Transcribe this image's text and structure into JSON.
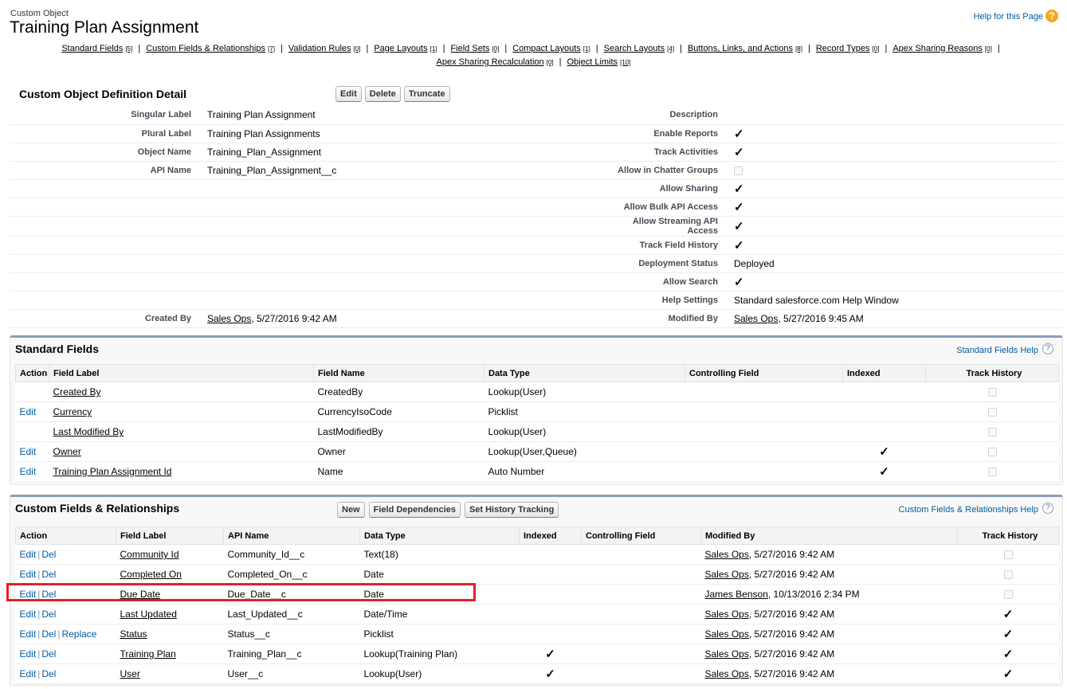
{
  "header": {
    "object_type": "Custom Object",
    "title": "Training Plan Assignment",
    "help_link": "Help for this Page",
    "help_icon": "?"
  },
  "related_links": [
    {
      "label": "Standard Fields",
      "count": "[5]"
    },
    {
      "label": "Custom Fields & Relationships",
      "count": "[7]"
    },
    {
      "label": "Validation Rules",
      "count": "[0]"
    },
    {
      "label": "Page Layouts",
      "count": "[1]"
    },
    {
      "label": "Field Sets",
      "count": "[0]"
    },
    {
      "label": "Compact Layouts",
      "count": "[1]"
    },
    {
      "label": "Search Layouts",
      "count": "[4]"
    },
    {
      "label": "Buttons, Links, and Actions",
      "count": "[8]"
    },
    {
      "label": "Record Types",
      "count": "[0]"
    },
    {
      "label": "Apex Sharing Reasons",
      "count": "[0]"
    },
    {
      "label": "Apex Sharing Recalculation",
      "count": "[0]"
    },
    {
      "label": "Object Limits",
      "count": "[10]"
    }
  ],
  "detail": {
    "title": "Custom Object Definition Detail",
    "buttons": {
      "edit": "Edit",
      "delete": "Delete",
      "truncate": "Truncate"
    },
    "left": [
      {
        "label": "Singular Label",
        "value": "Training Plan Assignment"
      },
      {
        "label": "Plural Label",
        "value": "Training Plan Assignments"
      },
      {
        "label": "Object Name",
        "value": "Training_Plan_Assignment"
      },
      {
        "label": "API Name",
        "value": "Training_Plan_Assignment__c"
      }
    ],
    "right": [
      {
        "label": "Description",
        "value": ""
      },
      {
        "label": "Enable Reports",
        "checked": true
      },
      {
        "label": "Track Activities",
        "checked": true
      },
      {
        "label": "Allow in Chatter Groups",
        "checked": false
      },
      {
        "label": "Allow Sharing",
        "checked": true
      },
      {
        "label": "Allow Bulk API Access",
        "checked": true
      },
      {
        "label": "Allow Streaming API Access",
        "checked": true
      },
      {
        "label": "Track Field History",
        "checked": true
      },
      {
        "label": "Deployment Status",
        "value": "Deployed"
      },
      {
        "label": "Allow Search",
        "checked": true
      },
      {
        "label": "Help Settings",
        "value": "Standard salesforce.com Help Window"
      }
    ],
    "created_by": {
      "label": "Created By",
      "user": "Sales Ops",
      "date": ", 5/27/2016 9:42 AM"
    },
    "modified_by": {
      "label": "Modified By",
      "user": "Sales Ops",
      "date": ", 5/27/2016 9:45 AM"
    }
  },
  "standard_fields": {
    "title": "Standard Fields",
    "help": "Standard Fields Help",
    "columns": [
      "Action",
      "Field Label",
      "Field Name",
      "Data Type",
      "Controlling Field",
      "Indexed",
      "Track History"
    ],
    "rows": [
      {
        "action": "",
        "label": "Created By",
        "name": "CreatedBy",
        "type": "Lookup(User)",
        "controlling": "",
        "indexed": false,
        "history": false
      },
      {
        "action": "Edit",
        "label": "Currency",
        "name": "CurrencyIsoCode",
        "type": "Picklist",
        "controlling": "",
        "indexed": false,
        "history": false
      },
      {
        "action": "",
        "label": "Last Modified By",
        "name": "LastModifiedBy",
        "type": "Lookup(User)",
        "controlling": "",
        "indexed": false,
        "history": false
      },
      {
        "action": "Edit",
        "label": "Owner",
        "name": "Owner",
        "type": "Lookup(User,Queue)",
        "controlling": "",
        "indexed": true,
        "history": false
      },
      {
        "action": "Edit",
        "label": "Training Plan Assignment Id",
        "name": "Name",
        "type": "Auto Number",
        "controlling": "",
        "indexed": true,
        "history": false
      }
    ]
  },
  "custom_fields": {
    "title": "Custom Fields & Relationships",
    "help": "Custom Fields & Relationships Help",
    "buttons": {
      "new": "New",
      "deps": "Field Dependencies",
      "history": "Set History Tracking"
    },
    "columns": [
      "Action",
      "Field Label",
      "API Name",
      "Data Type",
      "Indexed",
      "Controlling Field",
      "Modified By",
      "Track History"
    ],
    "action_labels": {
      "edit": "Edit",
      "del": "Del",
      "replace": "Replace",
      "sep": "|"
    },
    "rows": [
      {
        "replace": false,
        "label": "Community Id",
        "api": "Community_Id__c",
        "type": "Text(18)",
        "indexed": false,
        "user": "Sales Ops",
        "date": ", 5/27/2016 9:42 AM",
        "history": false
      },
      {
        "replace": false,
        "label": "Completed On",
        "api": "Completed_On__c",
        "type": "Date",
        "indexed": false,
        "user": "Sales Ops",
        "date": ", 5/27/2016 9:42 AM",
        "history": false
      },
      {
        "replace": false,
        "label": "Due Date",
        "api": "Due_Date__c",
        "type": "Date",
        "indexed": false,
        "user": "James Benson",
        "date": ", 10/13/2016 2:34 PM",
        "history": false
      },
      {
        "replace": false,
        "label": "Last Updated",
        "api": "Last_Updated__c",
        "type": "Date/Time",
        "indexed": false,
        "user": "Sales Ops",
        "date": ", 5/27/2016 9:42 AM",
        "history": true
      },
      {
        "replace": true,
        "label": "Status",
        "api": "Status__c",
        "type": "Picklist",
        "indexed": false,
        "user": "Sales Ops",
        "date": ", 5/27/2016 9:42 AM",
        "history": true
      },
      {
        "replace": false,
        "label": "Training Plan",
        "api": "Training_Plan__c",
        "type": "Lookup(Training Plan)",
        "indexed": true,
        "user": "Sales Ops",
        "date": ", 5/27/2016 9:42 AM",
        "history": true
      },
      {
        "replace": false,
        "label": "User",
        "api": "User__c",
        "type": "Lookup(User)",
        "indexed": true,
        "user": "Sales Ops",
        "date": ", 5/27/2016 9:42 AM",
        "history": true
      }
    ]
  },
  "check_glyph": "✓",
  "colors": {
    "link": "#015ba7",
    "highlight": "#e0202a",
    "section_border": "#8a9ebe"
  }
}
